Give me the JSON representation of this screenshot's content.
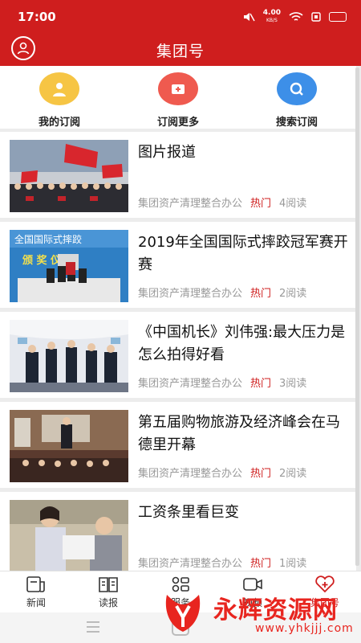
{
  "status": {
    "time": "17:00",
    "speed": "4.00",
    "speed_unit": "KB/S"
  },
  "header": {
    "title": "集团号"
  },
  "quick": [
    {
      "label": "我的订阅",
      "color": "#f6c544",
      "icon": "person-icon"
    },
    {
      "label": "订阅更多",
      "color": "#ef5a4f",
      "icon": "plus-icon"
    },
    {
      "label": "搜索订阅",
      "color": "#3d8fe8",
      "icon": "search-icon"
    }
  ],
  "articles": [
    {
      "title": "图片报道",
      "source": "集团资产清理整合办公",
      "tag": "热门",
      "reads": "4阅读"
    },
    {
      "title": "2019年全国国际式摔跤冠军赛开赛",
      "source": "集团资产清理整合办公",
      "tag": "热门",
      "reads": "2阅读"
    },
    {
      "title": "《中国机长》刘伟强:最大压力是怎么拍得好看",
      "source": "集团资产清理整合办公",
      "tag": "热门",
      "reads": "3阅读"
    },
    {
      "title": "第五届购物旅游及经济峰会在马德里开幕",
      "source": "集团资产清理整合办公",
      "tag": "热门",
      "reads": "2阅读"
    },
    {
      "title": "工资条里看巨变",
      "source": "集团资产清理整合办公",
      "tag": "热门",
      "reads": "1阅读"
    }
  ],
  "photo_banner": {
    "line1": "全国国际式摔跤",
    "line2": "颁 奖 仪 式"
  },
  "tabs": [
    {
      "label": "新闻",
      "icon": "news-icon"
    },
    {
      "label": "读报",
      "icon": "newspaper-icon"
    },
    {
      "label": "服务",
      "icon": "services-icon"
    },
    {
      "label": "视频",
      "icon": "video-icon"
    },
    {
      "label": "集团号",
      "icon": "heart-plus-icon"
    }
  ],
  "watermark": {
    "text": "永辉资源网",
    "url": "www.yhkjjj.com"
  },
  "colors": {
    "brand": "#cf1e1e"
  }
}
